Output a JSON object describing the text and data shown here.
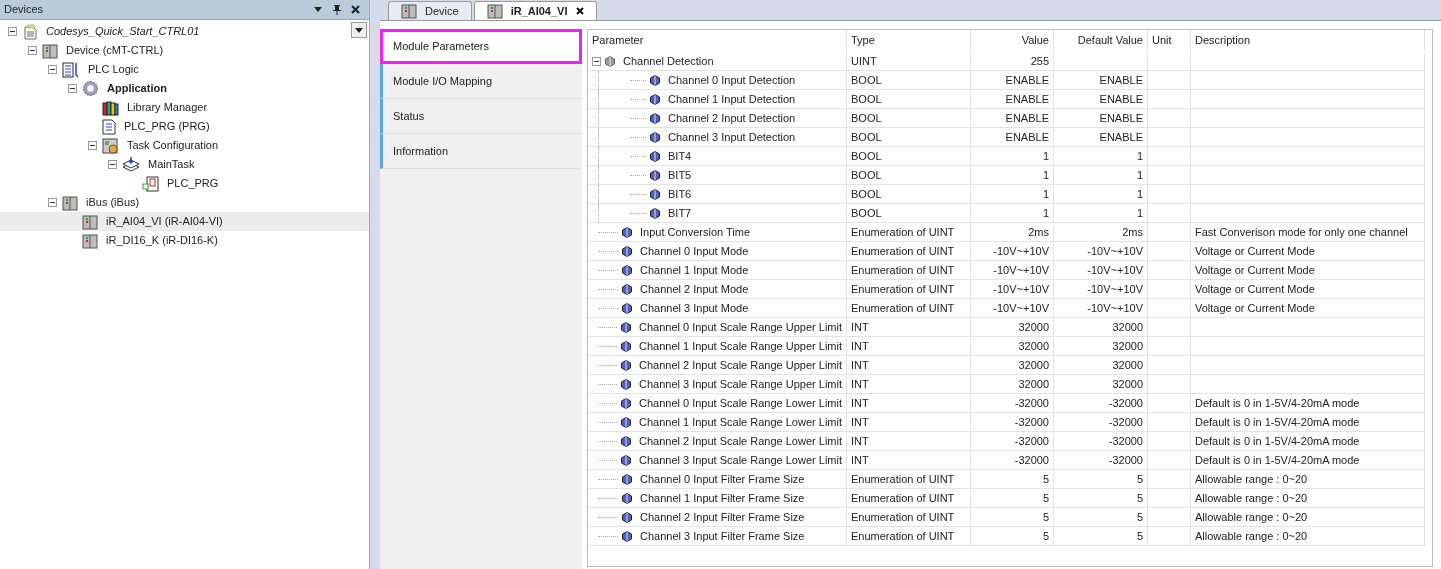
{
  "devices_panel": {
    "title": "Devices",
    "tree": [
      {
        "label": "Codesys_Quick_Start_CTRL01",
        "kind": "project",
        "expanded": true,
        "selected": false,
        "children": [
          {
            "label": "Device (cMT-CTRL)",
            "kind": "device",
            "expanded": true,
            "selected": false,
            "children": [
              {
                "label": "PLC Logic",
                "kind": "plc-logic",
                "expanded": true,
                "selected": false,
                "children": [
                  {
                    "label": "Application",
                    "kind": "application",
                    "expanded": true,
                    "selected": false,
                    "children": [
                      {
                        "label": "Library Manager",
                        "kind": "library",
                        "selected": false
                      },
                      {
                        "label": "PLC_PRG (PRG)",
                        "kind": "pou",
                        "selected": false
                      },
                      {
                        "label": "Task Configuration",
                        "kind": "task-config",
                        "expanded": true,
                        "selected": false,
                        "children": [
                          {
                            "label": "MainTask",
                            "kind": "task",
                            "expanded": true,
                            "selected": false,
                            "children": [
                              {
                                "label": "PLC_PRG",
                                "kind": "program-call",
                                "selected": false
                              }
                            ]
                          }
                        ]
                      }
                    ]
                  }
                ]
              },
              {
                "label": "iBus (iBus)",
                "kind": "device",
                "expanded": true,
                "selected": false,
                "children": [
                  {
                    "label": "iR_AI04_VI (iR-AI04-VI)",
                    "kind": "device",
                    "selected": true
                  },
                  {
                    "label": "iR_DI16_K (iR-DI16-K)",
                    "kind": "device",
                    "selected": false
                  }
                ]
              }
            ]
          }
        ]
      }
    ]
  },
  "editor_tabs": [
    {
      "label": "Device",
      "selected": false
    },
    {
      "label": "iR_AI04_VI",
      "selected": true
    }
  ],
  "module_tabs": [
    {
      "label": "Module Parameters",
      "selected": true
    },
    {
      "label": "Module I/O Mapping",
      "selected": false
    },
    {
      "label": "Status",
      "selected": false
    },
    {
      "label": "Information",
      "selected": false
    }
  ],
  "table": {
    "columns": [
      "Parameter",
      "Type",
      "Value",
      "Default Value",
      "Unit",
      "Description"
    ],
    "rows": [
      {
        "parameter": "Channel Detection",
        "type": "UINT",
        "value": "255",
        "expanded": true,
        "children": [
          {
            "parameter": "Channel 0 Input Detection",
            "type": "BOOL",
            "value": "ENABLE",
            "default": "ENABLE"
          },
          {
            "parameter": "Channel 1 Input Detection",
            "type": "BOOL",
            "value": "ENABLE",
            "default": "ENABLE"
          },
          {
            "parameter": "Channel 2 Input Detection",
            "type": "BOOL",
            "value": "ENABLE",
            "default": "ENABLE"
          },
          {
            "parameter": "Channel 3 Input Detection",
            "type": "BOOL",
            "value": "ENABLE",
            "default": "ENABLE"
          },
          {
            "parameter": "BIT4",
            "type": "BOOL",
            "value": "1",
            "default": "1"
          },
          {
            "parameter": "BIT5",
            "type": "BOOL",
            "value": "1",
            "default": "1"
          },
          {
            "parameter": "BIT6",
            "type": "BOOL",
            "value": "1",
            "default": "1"
          },
          {
            "parameter": "BIT7",
            "type": "BOOL",
            "value": "1",
            "default": "1"
          }
        ]
      },
      {
        "parameter": "Input Conversion Time",
        "type": "Enumeration of UINT",
        "value": "2ms",
        "default": "2ms",
        "description": "Fast Converison mode for only one channel"
      },
      {
        "parameter": "Channel 0 Input Mode",
        "type": "Enumeration of UINT",
        "value": "-10V~+10V",
        "default": "-10V~+10V",
        "description": "Voltage or Current Mode"
      },
      {
        "parameter": "Channel 1 Input Mode",
        "type": "Enumeration of UINT",
        "value": "-10V~+10V",
        "default": "-10V~+10V",
        "description": "Voltage or Current Mode"
      },
      {
        "parameter": "Channel 2 Input Mode",
        "type": "Enumeration of UINT",
        "value": "-10V~+10V",
        "default": "-10V~+10V",
        "description": "Voltage or Current Mode"
      },
      {
        "parameter": "Channel 3 Input Mode",
        "type": "Enumeration of UINT",
        "value": "-10V~+10V",
        "default": "-10V~+10V",
        "description": "Voltage or Current Mode"
      },
      {
        "parameter": "Channel 0 Input Scale Range Upper Limit",
        "type": "INT",
        "value": "32000",
        "default": "32000"
      },
      {
        "parameter": "Channel 1 Input Scale Range Upper Limit",
        "type": "INT",
        "value": "32000",
        "default": "32000"
      },
      {
        "parameter": "Channel 2 Input Scale Range Upper Limit",
        "type": "INT",
        "value": "32000",
        "default": "32000"
      },
      {
        "parameter": "Channel 3 Input Scale Range Upper Limit",
        "type": "INT",
        "value": "32000",
        "default": "32000"
      },
      {
        "parameter": "Channel 0 Input Scale Range Lower Limit",
        "type": "INT",
        "value": "-32000",
        "default": "-32000",
        "description": "Default is 0 in 1-5V/4-20mA mode"
      },
      {
        "parameter": "Channel 1 Input Scale Range Lower Limit",
        "type": "INT",
        "value": "-32000",
        "default": "-32000",
        "description": "Default is 0 in 1-5V/4-20mA mode"
      },
      {
        "parameter": "Channel 2 Input Scale Range Lower Limit",
        "type": "INT",
        "value": "-32000",
        "default": "-32000",
        "description": "Default is 0 in 1-5V/4-20mA mode"
      },
      {
        "parameter": "Channel 3 Input Scale Range Lower Limit",
        "type": "INT",
        "value": "-32000",
        "default": "-32000",
        "description": "Default is 0 in 1-5V/4-20mA mode"
      },
      {
        "parameter": "Channel 0 Input Filter Frame Size",
        "type": "Enumeration of UINT",
        "value": "5",
        "default": "5",
        "description": "Allowable range : 0~20"
      },
      {
        "parameter": "Channel 1 Input Filter Frame Size",
        "type": "Enumeration of UINT",
        "value": "5",
        "default": "5",
        "description": "Allowable range : 0~20"
      },
      {
        "parameter": "Channel 2 Input Filter Frame Size",
        "type": "Enumeration of UINT",
        "value": "5",
        "default": "5",
        "description": "Allowable range : 0~20"
      },
      {
        "parameter": "Channel 3 Input Filter Frame Size",
        "type": "Enumeration of UINT",
        "value": "5",
        "default": "5",
        "description": "Allowable range : 0~20"
      }
    ]
  }
}
